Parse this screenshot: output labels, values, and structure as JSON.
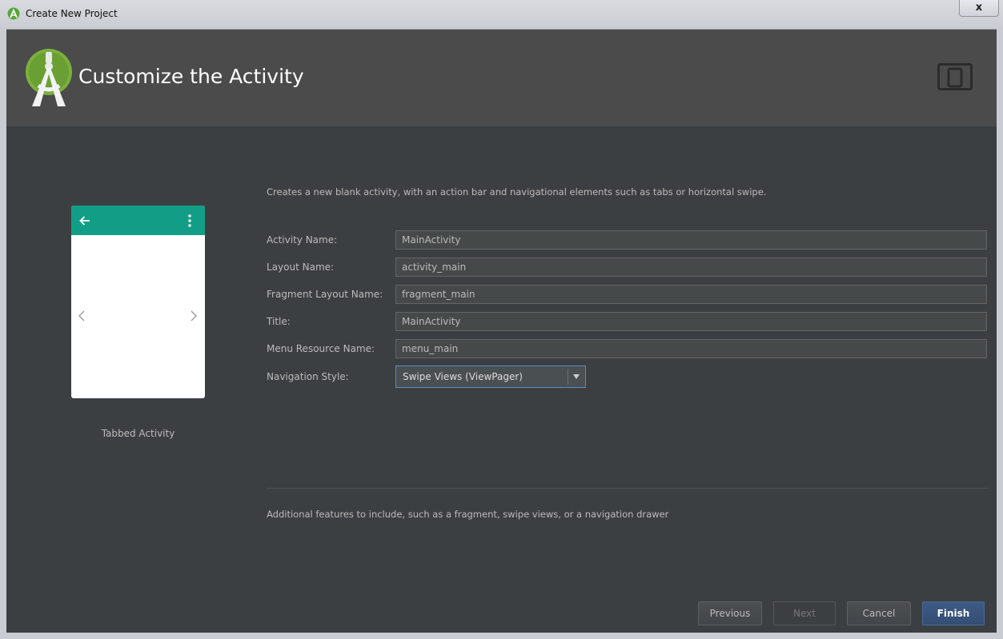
{
  "window": {
    "title": "Create New Project",
    "close_label": "x"
  },
  "header": {
    "title": "Customize the Activity"
  },
  "preview": {
    "label": "Tabbed Activity",
    "appbar_color": "#129e86"
  },
  "description": "Creates a new blank activity, with an action bar and navigational elements such as tabs or horizontal swipe.",
  "form": {
    "activity_name": {
      "label": "Activity Name:",
      "value": "MainActivity"
    },
    "layout_name": {
      "label": "Layout Name:",
      "value": "activity_main"
    },
    "fragment_layout_name": {
      "label": "Fragment Layout Name:",
      "value": "fragment_main"
    },
    "title": {
      "label": "Title:",
      "value": "MainActivity"
    },
    "menu_resource_name": {
      "label": "Menu Resource Name:",
      "value": "menu_main"
    },
    "navigation_style": {
      "label": "Navigation Style:",
      "value": "Swipe Views (ViewPager)"
    }
  },
  "hint": "Additional features to include, such as a fragment, swipe views, or a navigation drawer",
  "buttons": {
    "previous": "Previous",
    "next": "Next",
    "cancel": "Cancel",
    "finish": "Finish"
  },
  "icons": {
    "app": "android-studio-icon",
    "logo": "android-studio-logo",
    "device": "device-form-factor-icon"
  }
}
